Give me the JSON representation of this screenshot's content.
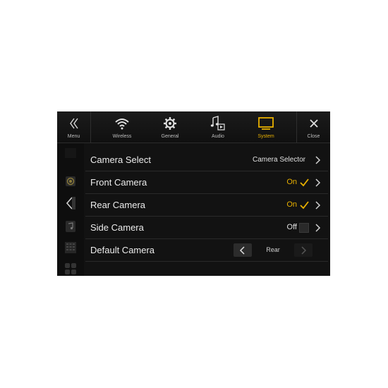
{
  "nav": {
    "menu_label": "Menu",
    "tabs": [
      {
        "label": "Wireless",
        "icon": "wifi-icon"
      },
      {
        "label": "General",
        "icon": "gear-icon"
      },
      {
        "label": "Audio",
        "icon": "music-note-icon"
      },
      {
        "label": "System",
        "icon": "monitor-icon",
        "active": true
      }
    ],
    "close_label": "Close",
    "active_color": "#e8b000"
  },
  "rows": [
    {
      "label": "Camera Select",
      "value": "Camera Selector"
    },
    {
      "label": "Front Camera",
      "value": "On",
      "checked": true
    },
    {
      "label": "Rear Camera",
      "value": "On",
      "checked": true
    },
    {
      "label": "Side Camera",
      "value": "Off",
      "checked": false
    },
    {
      "label": "Default Camera",
      "value": "Rear"
    }
  ]
}
